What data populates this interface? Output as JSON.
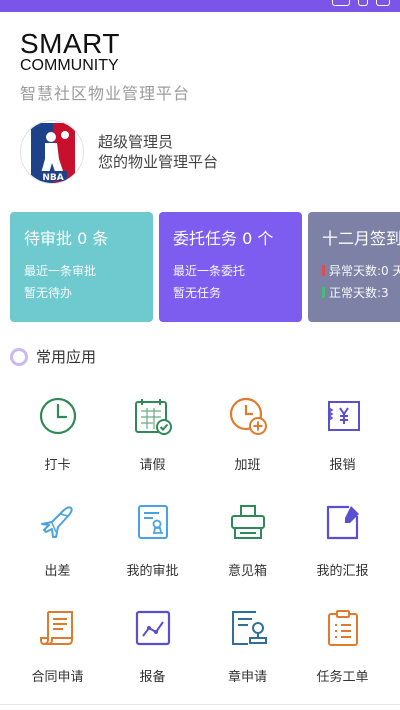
{
  "brand": {
    "title": "SMART",
    "subtitle": "COMMUNITY",
    "tagline_cn": "智慧社区物业管理平台"
  },
  "profile": {
    "name": "超级管理员",
    "description": "您的物业管理平台"
  },
  "cards": [
    {
      "title": "待审批 0 条",
      "line1": "最近一条审批",
      "line2": "暂无待办",
      "color": "#6fcacf"
    },
    {
      "title": "委托任务 0 个",
      "line1": "最近一条委托",
      "line2": "暂无任务",
      "color": "#7c5df0"
    },
    {
      "title": "十二月签到",
      "line1": "异常天数:0 天",
      "line2": "正常天数:3",
      "color": "#7d81a6",
      "abnormal_color": "#e64a4a",
      "normal_color": "#3fc46a"
    }
  ],
  "section": {
    "title": "常用应用"
  },
  "apps": [
    {
      "label": "打卡",
      "icon": "clock-icon"
    },
    {
      "label": "请假",
      "icon": "calendar-check-icon"
    },
    {
      "label": "加班",
      "icon": "overtime-clock-icon"
    },
    {
      "label": "报销",
      "icon": "receipt-yen-icon"
    },
    {
      "label": "出差",
      "icon": "airplane-icon"
    },
    {
      "label": "我的审批",
      "icon": "approval-document-icon"
    },
    {
      "label": "意见箱",
      "icon": "printer-box-icon"
    },
    {
      "label": "我的汇报",
      "icon": "note-edit-icon"
    },
    {
      "label": "合同申请",
      "icon": "contract-scroll-icon"
    },
    {
      "label": "报备",
      "icon": "report-chart-icon"
    },
    {
      "label": "章申请",
      "icon": "seal-stamp-icon"
    },
    {
      "label": "任务工单",
      "icon": "task-clipboard-icon"
    }
  ],
  "colors": {
    "accent": "#7a55e8",
    "green": "#2f8a57",
    "blue": "#4aa3df",
    "orange": "#e07b2e",
    "purple": "#5a4fcf"
  }
}
